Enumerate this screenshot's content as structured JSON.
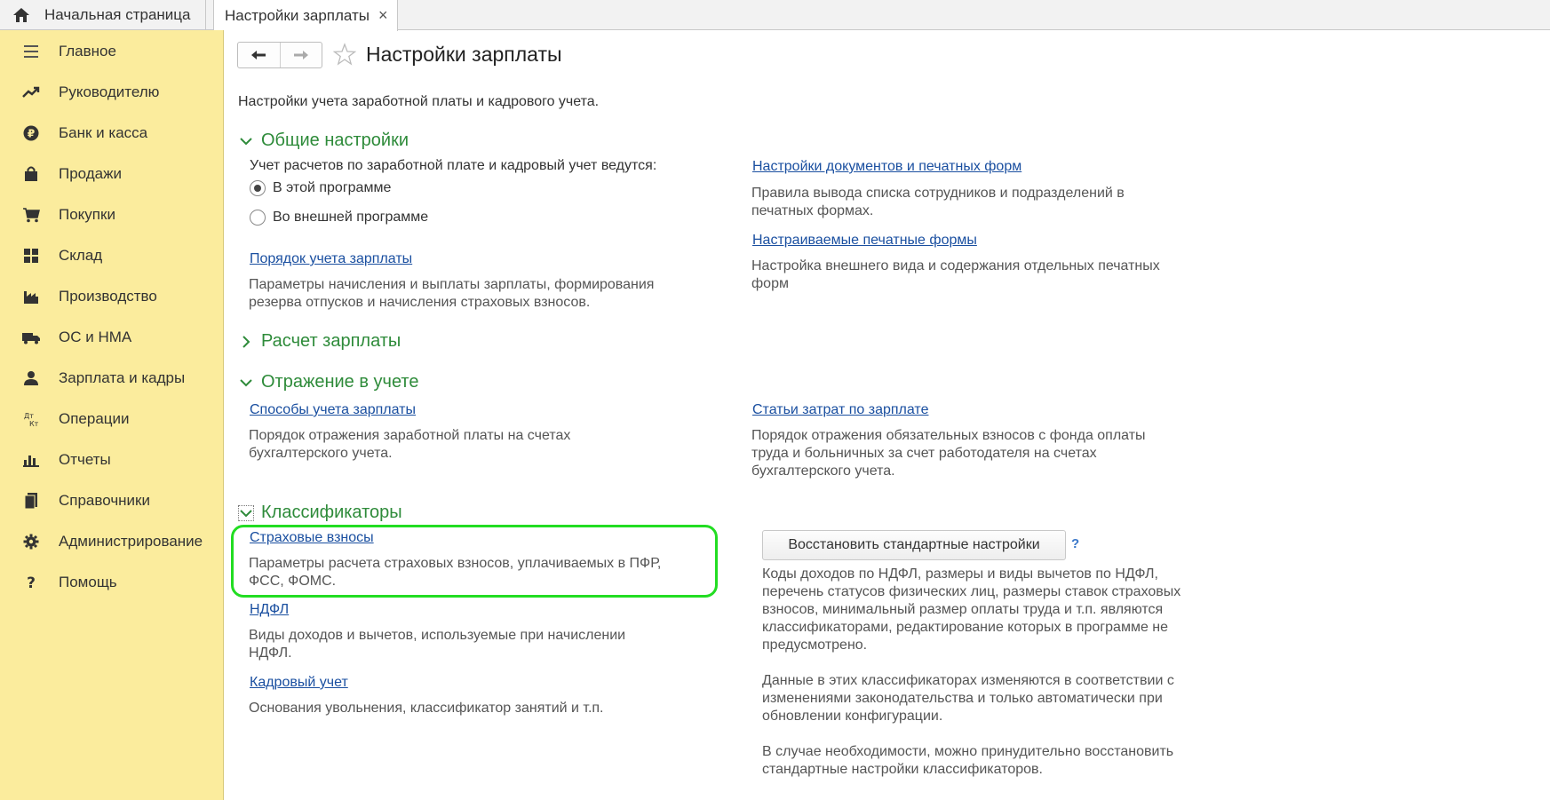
{
  "tabs": {
    "home_label": "Начальная страница",
    "active_label": "Настройки зарплаты",
    "close_glyph": "×"
  },
  "sidebar": {
    "items": [
      {
        "label": "Главное",
        "icon": "menu-lines-icon"
      },
      {
        "label": "Руководителю",
        "icon": "trend-icon"
      },
      {
        "label": "Банк и касса",
        "icon": "ruble-coin-icon"
      },
      {
        "label": "Продажи",
        "icon": "shopping-bag-icon"
      },
      {
        "label": "Покупки",
        "icon": "cart-icon"
      },
      {
        "label": "Склад",
        "icon": "warehouse-icon"
      },
      {
        "label": "Производство",
        "icon": "factory-icon"
      },
      {
        "label": "ОС и НМА",
        "icon": "truck-icon"
      },
      {
        "label": "Зарплата и кадры",
        "icon": "person-icon"
      },
      {
        "label": "Операции",
        "icon": "debit-credit-icon"
      },
      {
        "label": "Отчеты",
        "icon": "bar-chart-icon"
      },
      {
        "label": "Справочники",
        "icon": "books-icon"
      },
      {
        "label": "Администрирование",
        "icon": "gear-icon"
      },
      {
        "label": "Помощь",
        "icon": "question-icon"
      }
    ]
  },
  "header": {
    "title": "Настройки зарплаты",
    "back_glyph": "🡐",
    "forward_glyph": "🡒",
    "subtitle": "Настройки учета заработной платы и кадрового учета."
  },
  "general": {
    "title": "Общие настройки",
    "question": "Учет расчетов по заработной плате и кадровый учет ведутся:",
    "option_internal": "В этой программе",
    "option_external": "Во внешней программе",
    "selected": "В этой программе",
    "order_link": "Порядок учета зарплаты",
    "order_desc_1": "Параметры начисления и выплаты зарплаты, формирования",
    "order_desc_2": "резерва отпусков и начисления страховых взносов.",
    "docs_link": "Настройки документов и печатных форм",
    "docs_desc_1": "Правила вывода списка сотрудников и подразделений в",
    "docs_desc_2": "печатных формах.",
    "custom_forms_link": "Настраиваемые печатные формы",
    "custom_forms_desc_1": "Настройка внешнего вида и содержания отдельных печатных",
    "custom_forms_desc_2": "форм"
  },
  "payroll": {
    "title": "Расчет зарплаты"
  },
  "accounting": {
    "title": "Отражение в учете",
    "methods_link": "Способы учета зарплаты",
    "methods_desc_1": "Порядок отражения заработной платы на счетах",
    "methods_desc_2": "бухгалтерского учета.",
    "cost_link": "Статьи затрат по зарплате",
    "cost_desc_1": "Порядок отражения обязательных взносов с фонда оплаты",
    "cost_desc_2": "труда и больничных за счет работодателя на счетах",
    "cost_desc_3": "бухгалтерского учета."
  },
  "classifiers": {
    "title": "Классификаторы",
    "insurance_link": "Страховые взносы",
    "insurance_desc_1": "Параметры расчета страховых взносов, уплачиваемых в ПФР,",
    "insurance_desc_2": "ФСС, ФОМС.",
    "ndfl_link": "НДФЛ",
    "ndfl_desc_1": "Виды доходов и вычетов, используемые при начислении",
    "ndfl_desc_2": "НДФЛ.",
    "hr_link": "Кадровый учет",
    "hr_desc": "Основания увольнения, классификатор занятий и т.п.",
    "restore_button": "Восстановить стандартные настройки",
    "help_glyph": "?",
    "info_1": "Коды доходов по НДФЛ, размеры и виды вычетов по НДФЛ,",
    "info_2": "перечень статусов физических лиц, размеры ставок страховых",
    "info_3": "взносов, минимальный размер оплаты труда и т.п. являются",
    "info_4": "классификаторами, редактирование которых в программе не",
    "info_5": "предусмотрено.",
    "info_6": "Данные в этих классификаторах изменяются в соответствии с",
    "info_7": "изменениями законодательства и только автоматически при",
    "info_8": "обновлении конфигурации.",
    "info_9": "В случае необходимости, можно принудительно восстановить",
    "info_10": "стандартные настройки классификаторов."
  },
  "colors": {
    "sidebar_bg": "#fbec9d",
    "section_green": "#2e8b3a",
    "link_blue": "#1a4fa0",
    "highlight": "#22dd22"
  }
}
